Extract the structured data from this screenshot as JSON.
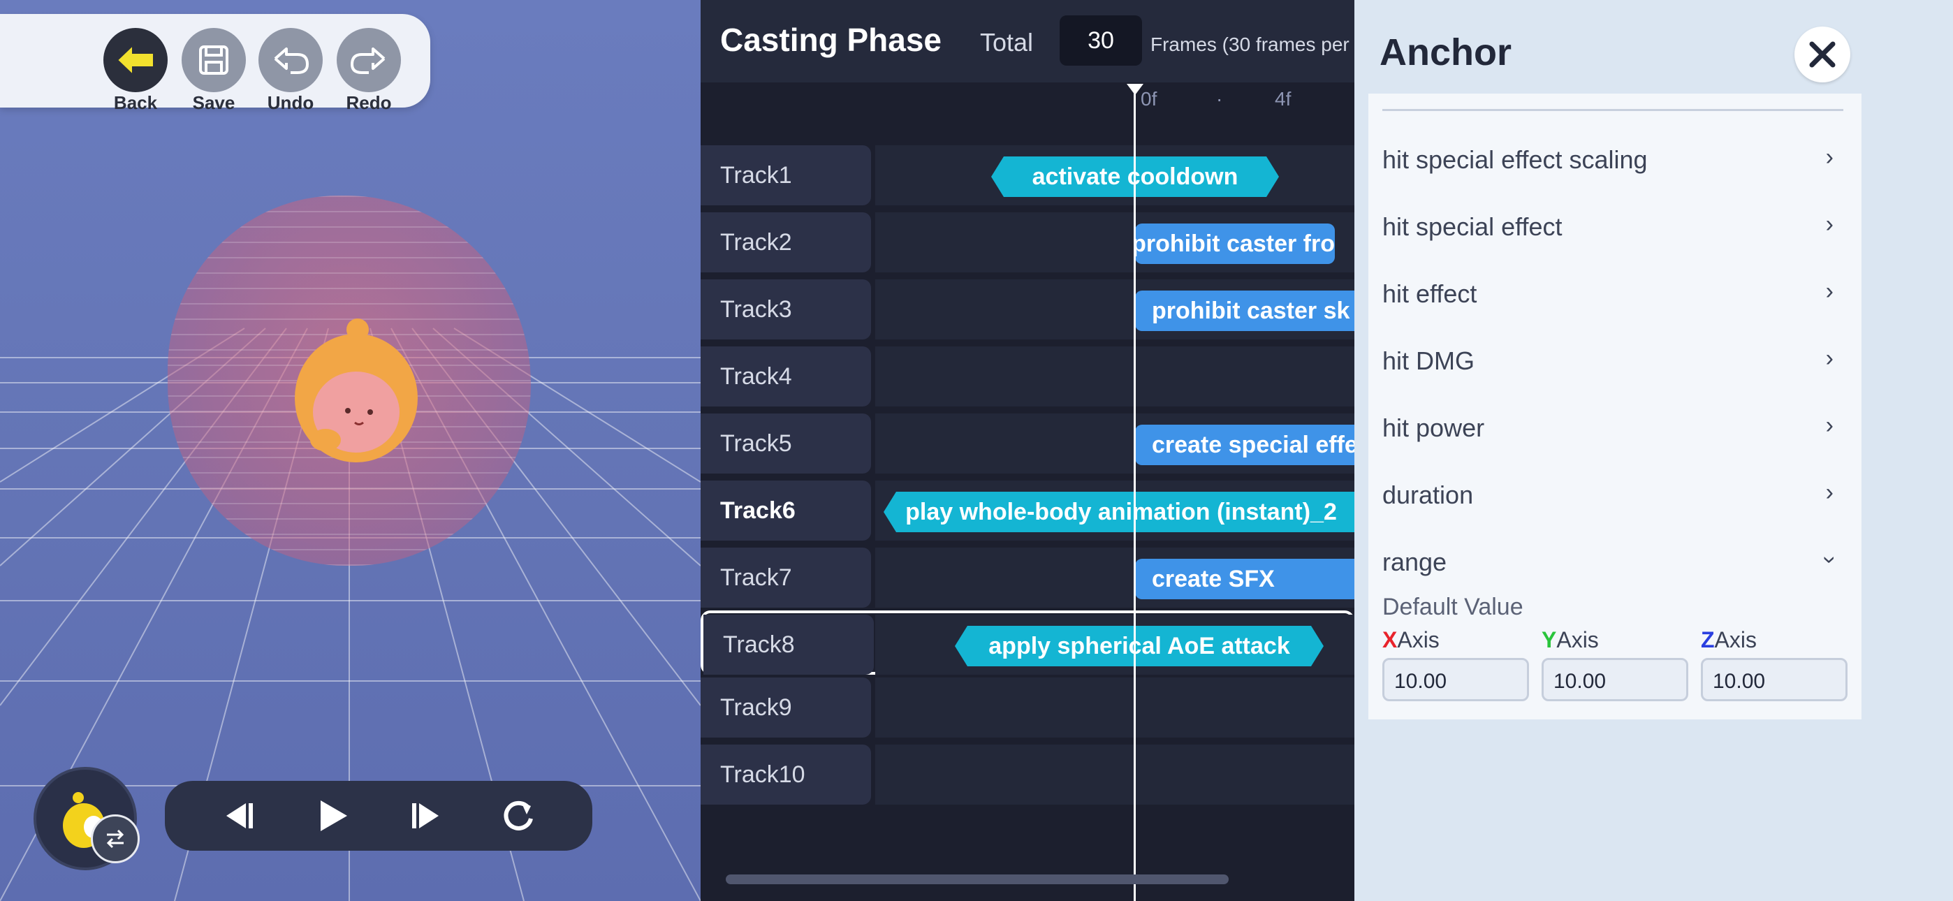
{
  "toolbar": {
    "back": "Back",
    "save": "Save",
    "undo": "Undo",
    "redo": "Redo"
  },
  "timeline": {
    "title": "Casting Phase",
    "total_label": "Total",
    "total_frames": "30",
    "frames_desc": "Frames (30 frames per",
    "ticks": [
      "0f",
      "·",
      "4f"
    ],
    "tracks": [
      {
        "label": "Track1",
        "clip": "activate cooldown"
      },
      {
        "label": "Track2",
        "clip": "prohibit caster fro"
      },
      {
        "label": "Track3",
        "clip": "prohibit caster sk"
      },
      {
        "label": "Track4",
        "clip": ""
      },
      {
        "label": "Track5",
        "clip": "create special effe"
      },
      {
        "label": "Track6",
        "clip": "play whole-body animation (instant)_2"
      },
      {
        "label": "Track7",
        "clip": "create SFX"
      },
      {
        "label": "Track8",
        "clip": "apply spherical AoE attack"
      },
      {
        "label": "Track9",
        "clip": ""
      },
      {
        "label": "Track10",
        "clip": ""
      }
    ]
  },
  "inspector": {
    "title": "Anchor",
    "properties": [
      {
        "label": "hit special effect scaling",
        "state": "collapsed"
      },
      {
        "label": "hit special effect",
        "state": "collapsed"
      },
      {
        "label": "hit effect",
        "state": "collapsed"
      },
      {
        "label": "hit DMG",
        "state": "collapsed"
      },
      {
        "label": "hit power",
        "state": "collapsed"
      },
      {
        "label": "duration",
        "state": "collapsed"
      },
      {
        "label": "range",
        "state": "expanded"
      }
    ],
    "default_value_label": "Default Value",
    "axes": [
      {
        "letter": "X",
        "name": "Axis",
        "value": "10.00"
      },
      {
        "letter": "Y",
        "name": "Axis",
        "value": "10.00"
      },
      {
        "letter": "Z",
        "name": "Axis",
        "value": "10.00"
      }
    ]
  },
  "colors": {
    "clip_cyan": "#14b5d3",
    "clip_blue": "#3f93e8",
    "timeline_bg": "#1c1f2e",
    "inspector_bg": "#dbe6f2"
  }
}
